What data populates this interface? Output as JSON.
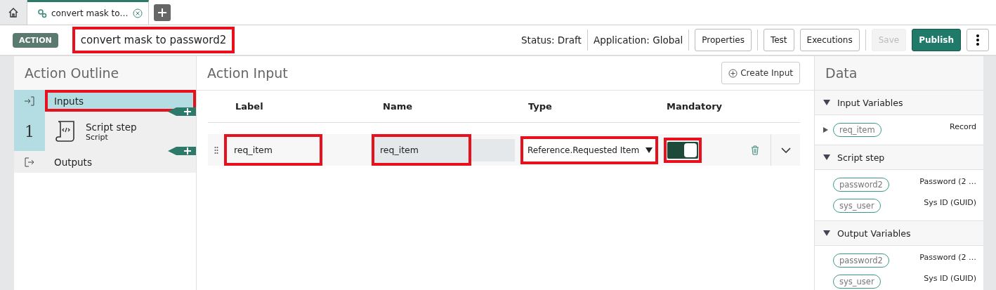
{
  "tabs": [
    {
      "kind": "home",
      "selected": false
    },
    {
      "kind": "doc",
      "label": "convert mask to…",
      "selected": true
    }
  ],
  "header": {
    "badge": "ACTION",
    "title": "convert mask to password2",
    "title_annotated": true,
    "status": "Status: Draft",
    "application": "Application: Global",
    "buttons": [
      {
        "label": "Properties",
        "kind": "plain",
        "disabled": false
      },
      {
        "label": "Test",
        "kind": "plain",
        "disabled": false
      },
      {
        "label": "Executions",
        "kind": "plain",
        "disabled": false
      },
      {
        "label": "Save",
        "kind": "plain",
        "disabled": true
      },
      {
        "label": "Publish",
        "kind": "primary",
        "disabled": false
      }
    ]
  },
  "outline": {
    "title": "Action Outline",
    "items": [
      {
        "kind": "inputs",
        "label": "Inputs",
        "selected": true,
        "annotated": true
      },
      {
        "kind": "step",
        "number": "1",
        "label": "Script step",
        "sub": "Script",
        "selected": false,
        "annotated": false
      },
      {
        "kind": "outputs",
        "label": "Outputs",
        "selected": false,
        "annotated": false
      }
    ]
  },
  "input_panel": {
    "title": "Action Input",
    "create_button": "Create Input",
    "columns": [
      "Label",
      "Name",
      "Type",
      "Mandatory"
    ],
    "rows": [
      {
        "label": "req_item",
        "name": "req_item",
        "type": "Reference.Requested Item",
        "mandatory": true,
        "annotated": true
      }
    ]
  },
  "data": {
    "title": "Data",
    "sections": [
      {
        "title": "Input Variables",
        "expanded": true,
        "vars": [
          {
            "name": "req_item",
            "type": "Record",
            "expandable": true
          }
        ]
      },
      {
        "title": "Script step",
        "expanded": true,
        "vars": [
          {
            "name": "password2",
            "type": "Password (2 …",
            "expandable": false
          },
          {
            "name": "sys_user",
            "type": "Sys ID (GUID)",
            "expandable": false
          }
        ]
      },
      {
        "title": "Output Variables",
        "expanded": true,
        "vars": [
          {
            "name": "password2",
            "type": "Password (2 …",
            "expandable": false
          },
          {
            "name": "sys_user",
            "type": "Sys ID (GUID)",
            "expandable": false
          }
        ]
      }
    ]
  }
}
